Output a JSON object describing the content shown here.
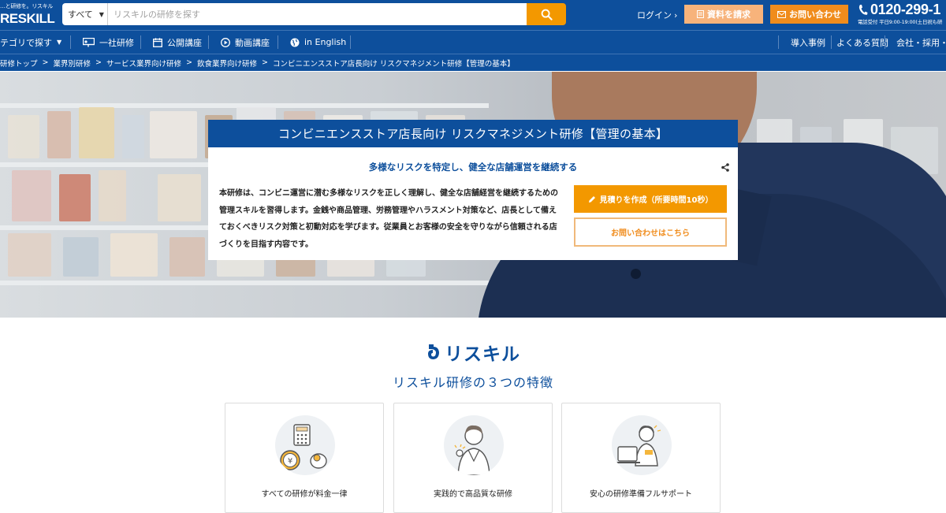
{
  "header": {
    "logo_tagline": "…と研修を。リスキル",
    "logo_name": "RESKILL",
    "search_category": "すべて",
    "search_placeholder": "リスキルの研修を探す",
    "login_label": "ログイン",
    "request_docs_label": "資料を請求",
    "contact_label": "お問い合わせ",
    "phone_number": "0120-299-1",
    "phone_hours": "電話受付 平日9:00-19:00(土日祝も研"
  },
  "nav": {
    "category_label": "テゴリで探す",
    "items": [
      {
        "label": "一社研修",
        "icon": "presentation-icon"
      },
      {
        "label": "公開講座",
        "icon": "calendar-icon"
      },
      {
        "label": "動画講座",
        "icon": "play-icon"
      },
      {
        "label": "in English",
        "icon": "globe-icon"
      }
    ],
    "right_items": [
      "導入事例",
      "よくある質問",
      "会社・採用・IR"
    ]
  },
  "breadcrumb": [
    "研修トップ",
    "業界別研修",
    "サービス業界向け研修",
    "飲食業界向け研修",
    "コンビニエンスストア店長向け リスクマネジメント研修【管理の基本】"
  ],
  "hero": {
    "title": "コンビニエンスストア店長向け リスクマネジメント研修【管理の基本】",
    "subtitle": "多様なリスクを特定し、健全な店舗運営を継続する",
    "description": "本研修は、コンビニ運営に潜む多様なリスクを正しく理解し、健全な店舗経営を継続するための管理スキルを習得します。金銭や商品管理、労務管理やハラスメント対策など、店長として備えておくべきリスク対策と初動対応を学びます。従業員とお客様の安全を守りながら信頼される店づくりを目指す内容です。",
    "estimate_button": "見積りを作成（所要時間10秒）",
    "inquiry_button": "お問い合わせはこちら"
  },
  "features": {
    "brand_text": "リスキル",
    "heading": "リスキル研修の３つの特徴",
    "cards": [
      {
        "label": "すべての研修が料金一律",
        "icon": "calculator-coin-icon"
      },
      {
        "label": "実践的で高品質な研修",
        "icon": "instructor-icon"
      },
      {
        "label": "安心の研修準備フルサポート",
        "icon": "support-operator-icon"
      }
    ]
  },
  "colors": {
    "brand_blue": "#0d4f9c",
    "accent_orange": "#f39800",
    "light_orange": "#f7b37b"
  }
}
